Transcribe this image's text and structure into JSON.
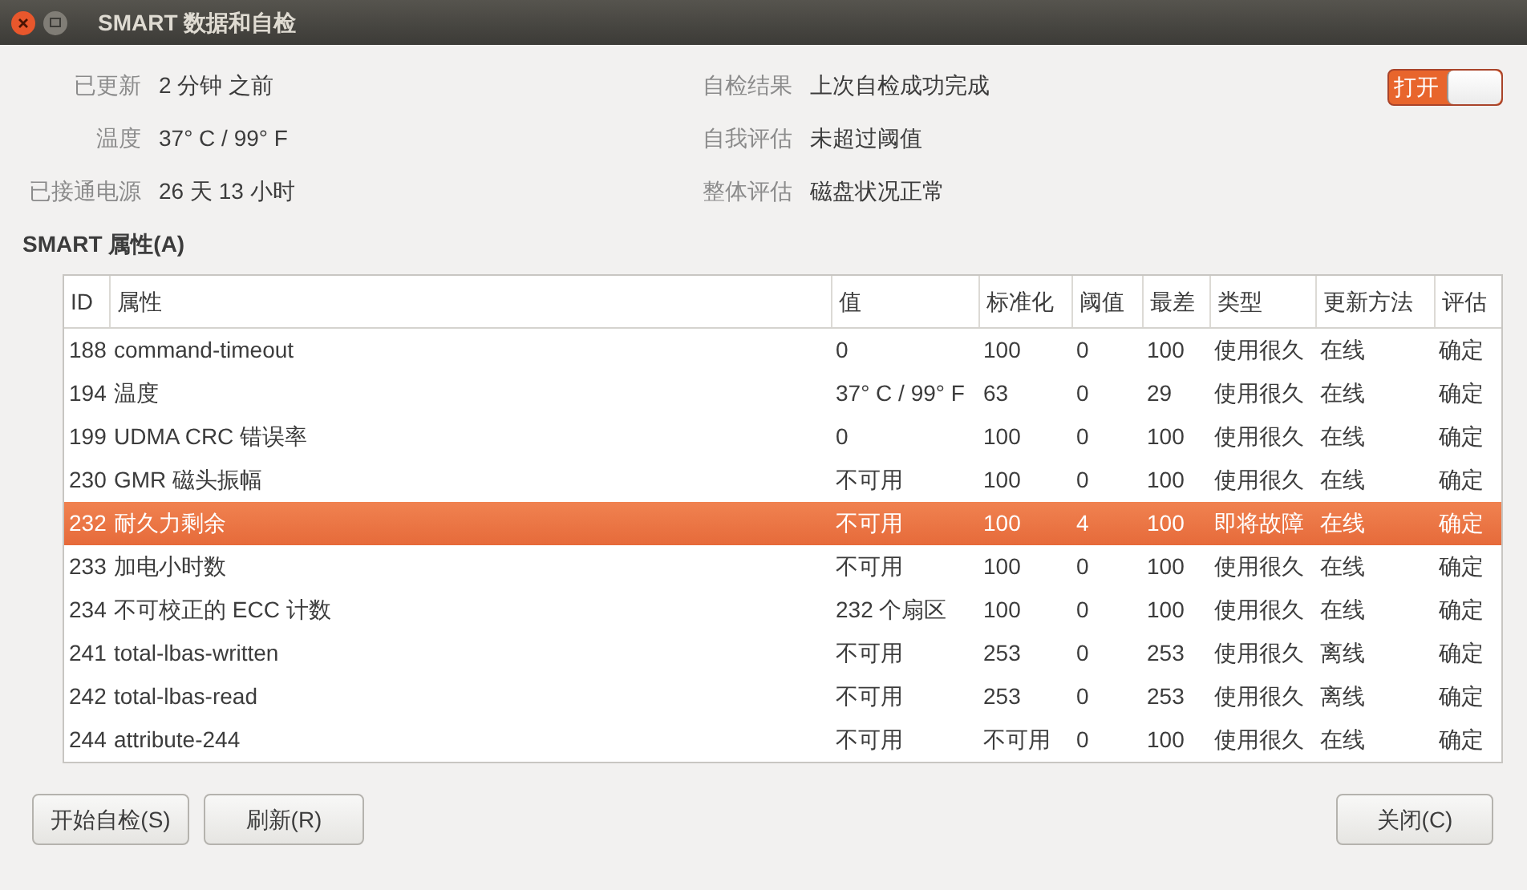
{
  "window": {
    "title": "SMART 数据和自检"
  },
  "info_left": [
    {
      "label": "已更新",
      "value": "2 分钟 之前"
    },
    {
      "label": "温度",
      "value": "37° C / 99° F"
    },
    {
      "label": "已接通电源",
      "value": "26 天 13 小时"
    }
  ],
  "info_right": [
    {
      "label": "自检结果",
      "value": "上次自检成功完成"
    },
    {
      "label": "自我评估",
      "value": "未超过阈值"
    },
    {
      "label": "整体评估",
      "value": "磁盘状况正常"
    }
  ],
  "smart_switch": {
    "label": "打开",
    "on": true
  },
  "section_title": "SMART 属性(A)",
  "table": {
    "columns": [
      "ID",
      "属性",
      "值",
      "标准化",
      "阈值",
      "最差",
      "类型",
      "更新方法",
      "评估"
    ],
    "rows": [
      {
        "cells": [
          "188",
          "command-timeout",
          "0",
          "100",
          "0",
          "100",
          "使用很久",
          "在线",
          "确定"
        ],
        "selected": false
      },
      {
        "cells": [
          "194",
          "温度",
          "37° C / 99° F",
          "63",
          "0",
          "29",
          "使用很久",
          "在线",
          "确定"
        ],
        "selected": false
      },
      {
        "cells": [
          "199",
          "UDMA CRC 错误率",
          "0",
          "100",
          "0",
          "100",
          "使用很久",
          "在线",
          "确定"
        ],
        "selected": false
      },
      {
        "cells": [
          "230",
          "GMR 磁头振幅",
          "不可用",
          "100",
          "0",
          "100",
          "使用很久",
          "在线",
          "确定"
        ],
        "selected": false
      },
      {
        "cells": [
          "232",
          "耐久力剩余",
          "不可用",
          "100",
          "4",
          "100",
          "即将故障",
          "在线",
          "确定"
        ],
        "selected": true
      },
      {
        "cells": [
          "233",
          "加电小时数",
          "不可用",
          "100",
          "0",
          "100",
          "使用很久",
          "在线",
          "确定"
        ],
        "selected": false
      },
      {
        "cells": [
          "234",
          "不可校正的 ECC 计数",
          "232 个扇区",
          "100",
          "0",
          "100",
          "使用很久",
          "在线",
          "确定"
        ],
        "selected": false
      },
      {
        "cells": [
          "241",
          "total-lbas-written",
          "不可用",
          "253",
          "0",
          "253",
          "使用很久",
          "离线",
          "确定"
        ],
        "selected": false
      },
      {
        "cells": [
          "242",
          "total-lbas-read",
          "不可用",
          "253",
          "0",
          "253",
          "使用很久",
          "离线",
          "确定"
        ],
        "selected": false
      },
      {
        "cells": [
          "244",
          "attribute-244",
          "不可用",
          "不可用",
          "0",
          "100",
          "使用很久",
          "在线",
          "确定"
        ],
        "selected": false
      }
    ]
  },
  "buttons_left": [
    "开始自检(S)",
    "刷新(R)"
  ],
  "buttons_right": [
    "关闭(C)"
  ]
}
